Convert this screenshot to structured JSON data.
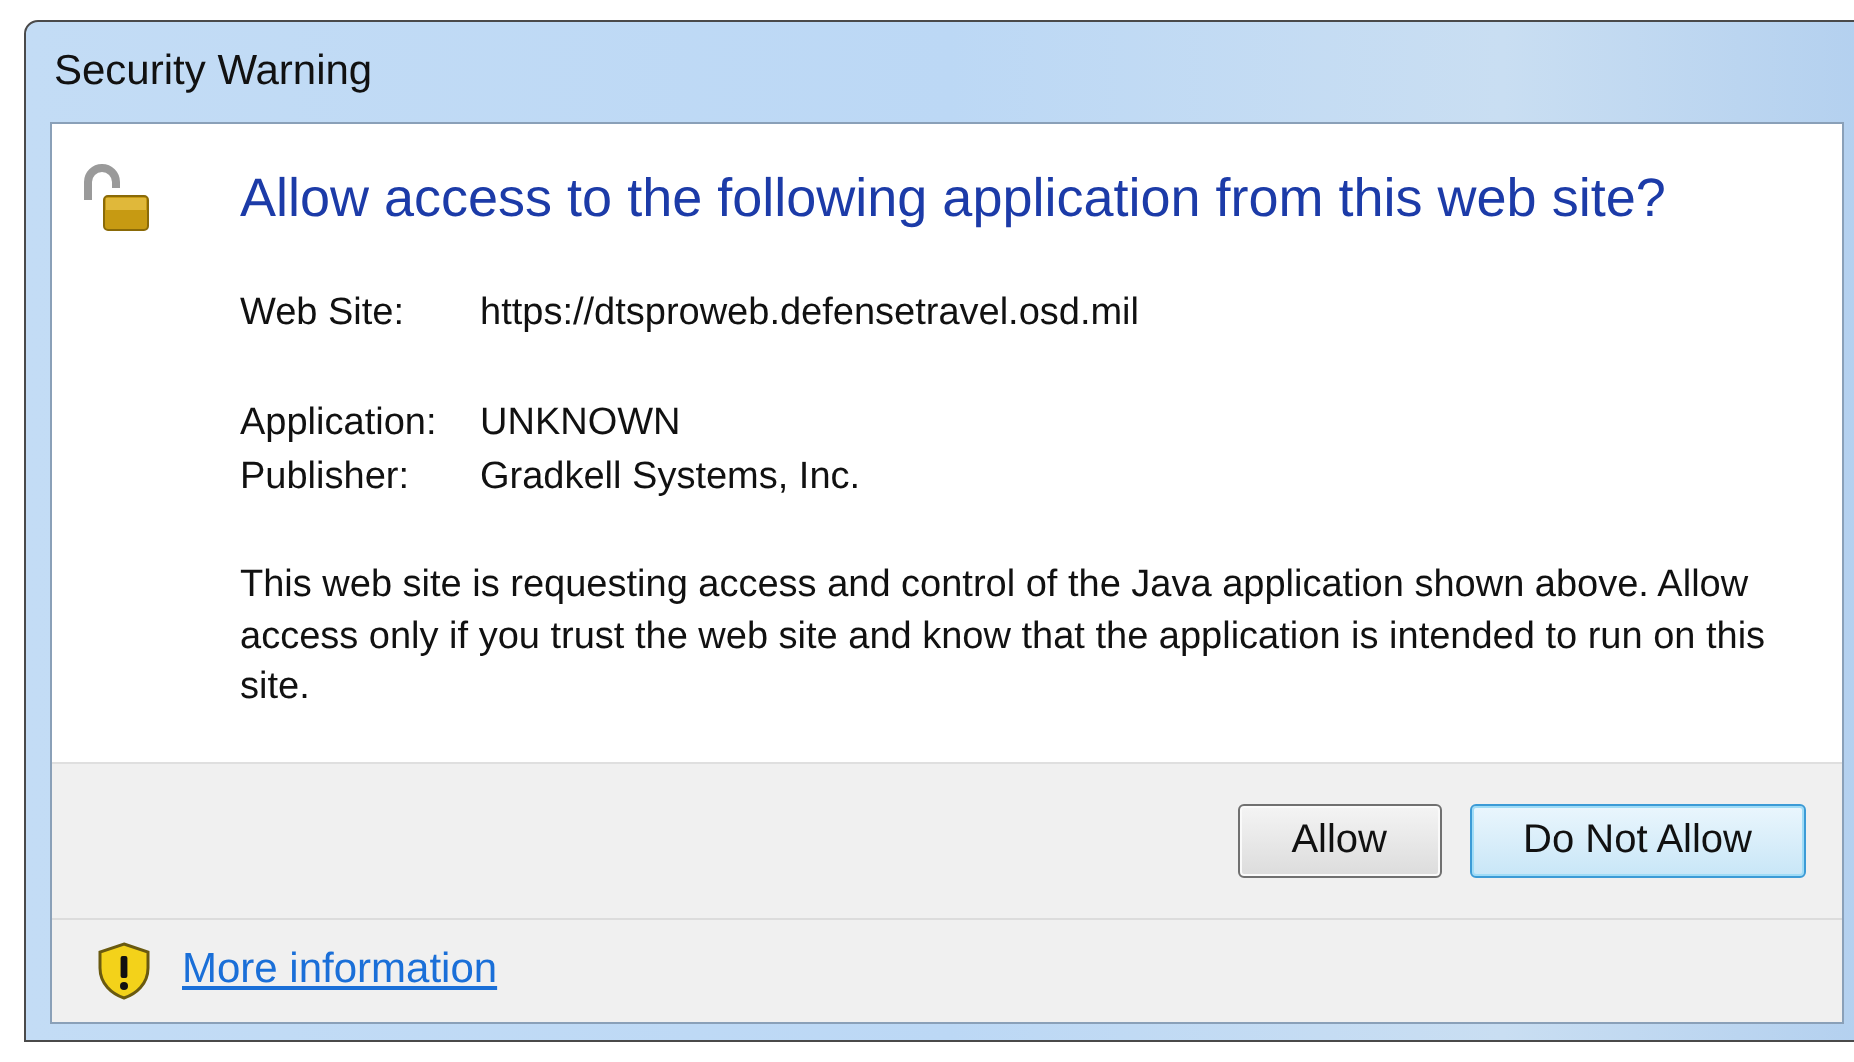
{
  "window": {
    "title": "Security Warning"
  },
  "heading": "Allow access to the following application from this web site?",
  "detail_groups": [
    [
      {
        "label": "Web Site:",
        "value": "https://dtsproweb.defensetravel.osd.mil"
      }
    ],
    [
      {
        "label": "Application:",
        "value": "UNKNOWN"
      },
      {
        "label": "Publisher:",
        "value": "Gradkell Systems, Inc."
      }
    ]
  ],
  "message": "This web site is requesting access and control of the Java application shown above. Allow access only if you trust the web site and know that the application is intended to run on this site.",
  "buttons": [
    {
      "label": "Allow",
      "default": false
    },
    {
      "label": "Do Not Allow",
      "default": true
    }
  ],
  "footer": {
    "link": "More information"
  }
}
